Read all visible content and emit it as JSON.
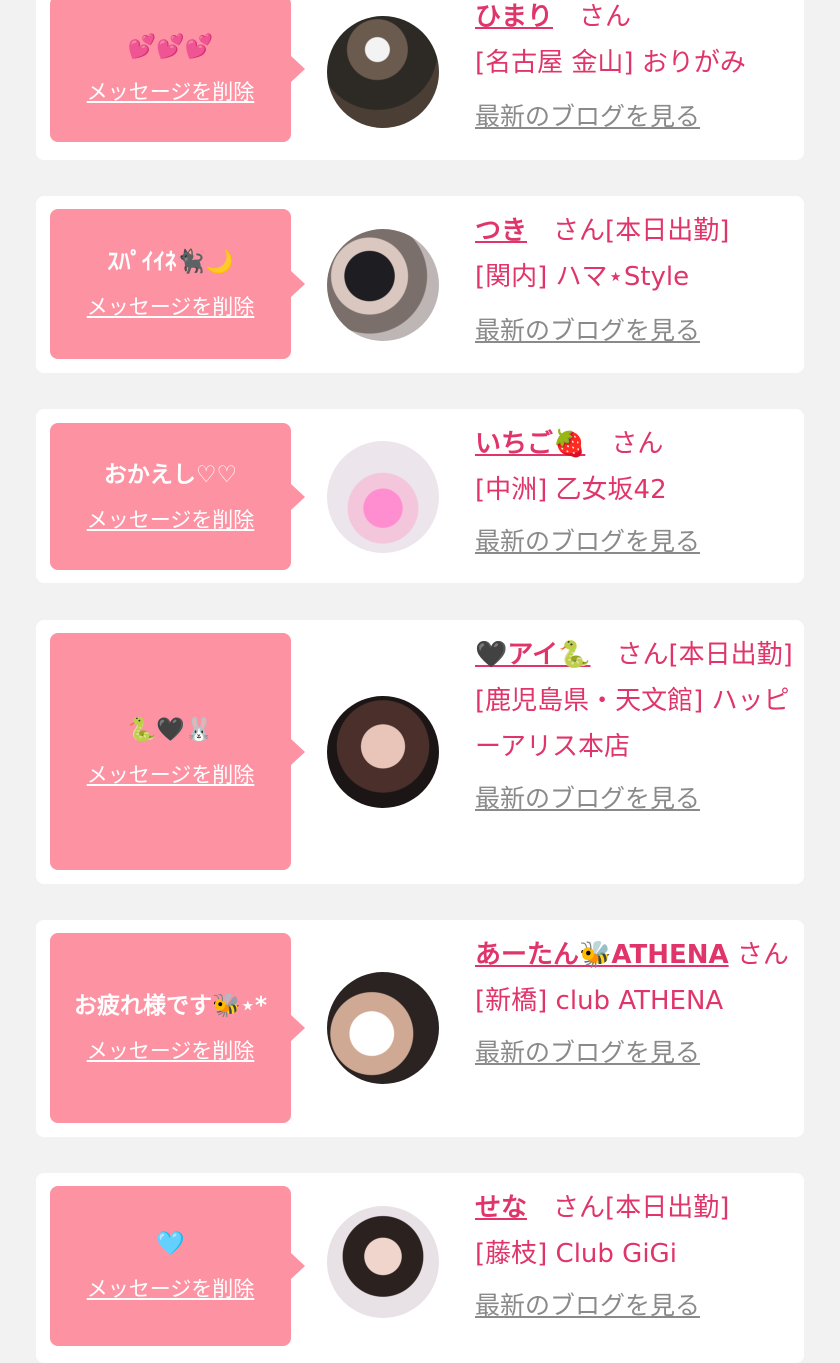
{
  "colors": {
    "accent": "#e0356a",
    "bubble": "#fd92a3",
    "background": "#f2f2f2",
    "link_gray": "#8a8a8a"
  },
  "labels": {
    "delete": "メッセージを削除",
    "blog": "最新のブログを見る"
  },
  "entries": [
    {
      "message": "💕💕💕",
      "name": "ひまり",
      "honorific": "さん",
      "status": "",
      "shop": "[名古屋 金山] おりがみ"
    },
    {
      "message": "ｽﾊﾟｲｲﾈ🐈‍⬛🌙",
      "name": "つき",
      "honorific": "さん",
      "status": "[本日出勤]",
      "shop": "[関内] ハマ⋆Style"
    },
    {
      "message": "おかえし♡♡",
      "name": "いちご🍓",
      "honorific": "さん",
      "status": "",
      "shop": "[中洲] 乙女坂42"
    },
    {
      "message": "🐍🖤🐰",
      "name": "🖤アイ🐍",
      "honorific": "さん",
      "status": "[本日出勤]",
      "shop": "[鹿児島県・天文館] ハッピーアリス本店"
    },
    {
      "message": "お疲れ様です🐝⋆*",
      "name": "あーたん🐝ATHENA",
      "honorific": "さん",
      "status": "",
      "shop": "[新橋] club ATHENA"
    },
    {
      "message": "🩵",
      "name": "せな",
      "honorific": "さん",
      "status": "[本日出勤]",
      "shop": "[藤枝] Club GiGi"
    }
  ]
}
